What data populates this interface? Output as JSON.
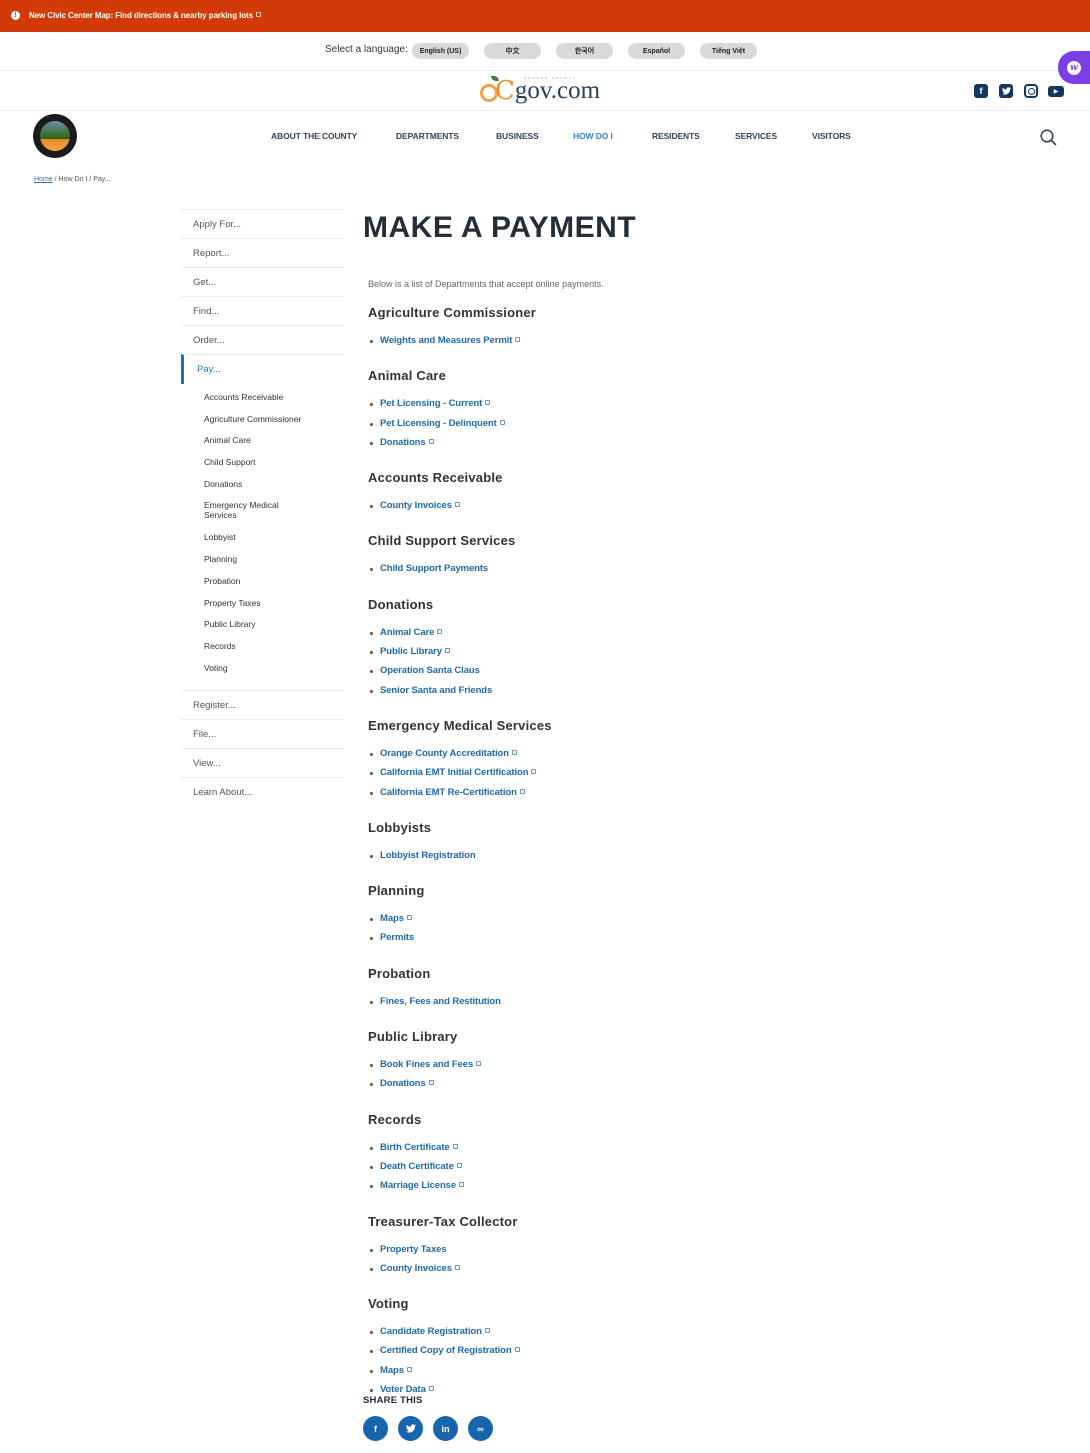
{
  "alert": {
    "icon": "info-icon",
    "text": "New Civic Center Map:  Find directions & nearby parking lots"
  },
  "language": {
    "label": "Select a language:",
    "options": [
      "English (US)",
      "中文",
      "한국어",
      "Español",
      "Tiếng Việt"
    ]
  },
  "logo": {
    "tagline": "ORANGE COUNTY",
    "brand_c": "C",
    "brand_rest": "gov.com"
  },
  "social_top": [
    "facebook-icon",
    "twitter-icon",
    "instagram-icon",
    "youtube-icon"
  ],
  "nav": {
    "items": [
      "ABOUT THE COUNTY",
      "DEPARTMENTS",
      "BUSINESS",
      "HOW DO I",
      "RESIDENTS",
      "SERVICES",
      "VISITORS"
    ],
    "active": "HOW DO I"
  },
  "breadcrumb": {
    "home": "Home",
    "sep": "/",
    "level2": "How Do I",
    "level3": "Pay..."
  },
  "sidebar": {
    "top_items": [
      "Apply For...",
      "Report...",
      "Get...",
      "Find...",
      "Order..."
    ],
    "active_item": "Pay...",
    "sub_items": [
      "Accounts Receivable",
      "Agriculture Commissioner",
      "Animal Care",
      "Child Support",
      "Donations",
      "Emergency Medical Services",
      "Lobbyist",
      "Planning",
      "Probation",
      "Property Taxes",
      "Public Library",
      "Records",
      "Voting"
    ],
    "bottom_items": [
      "Register...",
      "File...",
      "View...",
      "Learn About..."
    ]
  },
  "main": {
    "title": "MAKE A PAYMENT",
    "intro": "Below is a list of Departments that accept online payments.",
    "sections": [
      {
        "heading": "Agriculture Commissioner",
        "links": [
          {
            "label": "Weights and Measures Permit",
            "external": true
          }
        ]
      },
      {
        "heading": "Animal Care",
        "links": [
          {
            "label": "Pet Licensing - Current",
            "external": true
          },
          {
            "label": "Pet Licensing - Delinquent",
            "external": true
          },
          {
            "label": "Donations",
            "external": true
          }
        ]
      },
      {
        "heading": "Accounts Receivable",
        "links": [
          {
            "label": "County Invoices",
            "external": true
          }
        ]
      },
      {
        "heading": "Child Support Services",
        "links": [
          {
            "label": "Child Support Payments",
            "external": false
          }
        ]
      },
      {
        "heading": "Donations",
        "links": [
          {
            "label": "Animal Care",
            "external": true
          },
          {
            "label": "Public Library",
            "external": true
          },
          {
            "label": "Operation Santa Claus",
            "external": false
          },
          {
            "label": "Senior Santa and Friends",
            "external": false
          }
        ]
      },
      {
        "heading": "Emergency Medical Services",
        "links": [
          {
            "label": "Orange County Accreditation",
            "external": true
          },
          {
            "label": "California EMT Initial Certification",
            "external": true
          },
          {
            "label": "California EMT Re-Certification",
            "external": true
          }
        ]
      },
      {
        "heading": "Lobbyists",
        "links": [
          {
            "label": "Lobbyist Registration",
            "external": false
          }
        ]
      },
      {
        "heading": "Planning",
        "links": [
          {
            "label": "Maps",
            "external": true
          },
          {
            "label": "Permits",
            "external": false
          }
        ]
      },
      {
        "heading": "Probation",
        "links": [
          {
            "label": "Fines, Fees and Restitution",
            "external": false
          }
        ]
      },
      {
        "heading": "Public Library",
        "links": [
          {
            "label": "Book Fines and Fees",
            "external": true
          },
          {
            "label": "Donations",
            "external": true
          }
        ]
      },
      {
        "heading": "Records",
        "links": [
          {
            "label": "Birth Certificate",
            "external": true
          },
          {
            "label": "Death Certificate",
            "external": true
          },
          {
            "label": "Marriage License",
            "external": true
          }
        ]
      },
      {
        "heading": "Treasurer-Tax Collector",
        "links": [
          {
            "label": "Property Taxes",
            "external": false
          },
          {
            "label": "County Invoices",
            "external": true
          }
        ]
      },
      {
        "heading": "Voting",
        "links": [
          {
            "label": "Candidate Registration",
            "external": true
          },
          {
            "label": "Certified Copy of Registration",
            "external": true
          },
          {
            "label": "Maps",
            "external": true
          },
          {
            "label": "Voter Data",
            "external": true
          }
        ]
      }
    ]
  },
  "share": {
    "label": "SHARE THIS",
    "buttons": [
      {
        "name": "facebook",
        "glyph": "f"
      },
      {
        "name": "twitter",
        "glyph": "t"
      },
      {
        "name": "linkedin",
        "glyph": "in"
      },
      {
        "name": "copy-link",
        "glyph": "∞"
      }
    ]
  },
  "colors": {
    "alert_bg": "#d23b07",
    "link": "#1f6aab",
    "nav_active": "#3a84c3",
    "nav": "#34455e",
    "share_bg": "#1765ad",
    "widget": "#7b3fe4"
  }
}
